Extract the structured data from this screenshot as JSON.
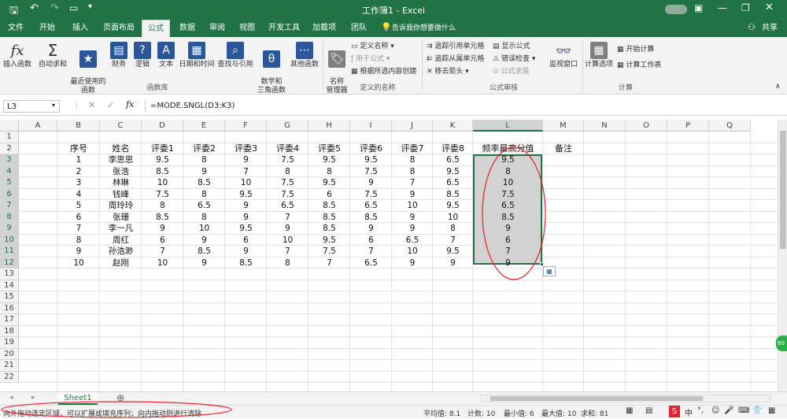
{
  "window": {
    "title": "工作簿1 - Excel"
  },
  "tabs": [
    "文件",
    "开始",
    "插入",
    "页面布局",
    "公式",
    "数据",
    "审阅",
    "视图",
    "开发工具",
    "加载项",
    "团队"
  ],
  "active_tab": "公式",
  "tell_me": "告诉我你想要做什么",
  "share": "共享",
  "ribbon": {
    "function_library": {
      "insert_function": "插入函数",
      "autosum": "自动求和",
      "recent": "最近使用的\n函数",
      "financial": "财务",
      "logical": "逻辑",
      "text": "文本",
      "datetime": "日期和时间",
      "lookup": "查找与引用",
      "math": "数学和\n三角函数",
      "more": "其他函数",
      "group": "函数库"
    },
    "defined_names": {
      "name_manager": "名称\n管理器",
      "define_name": "定义名称",
      "use_in_formula": "用于公式",
      "create_from_selection": "根据所选内容创建",
      "group": "定义的名称"
    },
    "formula_auditing": {
      "trace_precedents": "追踪引用单元格",
      "trace_dependents": "追踪从属单元格",
      "remove_arrows": "移去箭头",
      "show_formulas": "显示公式",
      "error_checking": "错误检查",
      "evaluate_formula": "公式求值",
      "watch_window": "监视窗口",
      "group": "公式审核"
    },
    "calculation": {
      "options": "计算选项",
      "calc_now": "开始计算",
      "calc_sheet": "计算工作表",
      "group": "计算"
    }
  },
  "formula_bar": {
    "name_box": "L3",
    "fx": "fx",
    "formula": "=MODE.SNGL(D3:K3)"
  },
  "columns": [
    "A",
    "B",
    "C",
    "D",
    "E",
    "F",
    "G",
    "H",
    "I",
    "J",
    "K",
    "L",
    "M",
    "N",
    "O",
    "P",
    "Q"
  ],
  "rows": [
    "1",
    "2",
    "3",
    "4",
    "5",
    "6",
    "7",
    "8",
    "9",
    "10",
    "11",
    "12",
    "13",
    "14",
    "15",
    "16",
    "17",
    "18",
    "19",
    "20",
    "21",
    "22"
  ],
  "headers": [
    "序号",
    "姓名",
    "评委1",
    "评委2",
    "评委3",
    "评委4",
    "评委5",
    "评委6",
    "评委7",
    "评委8",
    "频率最高分值",
    "备注"
  ],
  "data_rows": [
    [
      "1",
      "李思思",
      "9.5",
      "8",
      "9",
      "7.5",
      "9.5",
      "9.5",
      "8",
      "6.5",
      "9.5"
    ],
    [
      "2",
      "张浩",
      "8.5",
      "9",
      "7",
      "8",
      "8",
      "7.5",
      "8",
      "9.5",
      "8"
    ],
    [
      "3",
      "林琳",
      "10",
      "8.5",
      "10",
      "7.5",
      "9.5",
      "9",
      "7",
      "6.5",
      "10"
    ],
    [
      "4",
      "钱峰",
      "7.5",
      "8",
      "9.5",
      "7.5",
      "6",
      "7.5",
      "9",
      "8.5",
      "7.5"
    ],
    [
      "5",
      "周玲玲",
      "8",
      "6.5",
      "9",
      "6.5",
      "8.5",
      "6.5",
      "10",
      "9.5",
      "6.5"
    ],
    [
      "6",
      "张珊",
      "8.5",
      "8",
      "9",
      "7",
      "8.5",
      "8.5",
      "9",
      "10",
      "8.5"
    ],
    [
      "7",
      "李一凡",
      "9",
      "10",
      "9.5",
      "9",
      "8.5",
      "9",
      "9",
      "8",
      "9"
    ],
    [
      "8",
      "周红",
      "6",
      "9",
      "6",
      "10",
      "9.5",
      "6",
      "6.5",
      "7",
      "6"
    ],
    [
      "9",
      "孙浩渺",
      "7",
      "8.5",
      "9",
      "7",
      "7.5",
      "7",
      "10",
      "9.5",
      "7"
    ],
    [
      "10",
      "赵刚",
      "10",
      "9",
      "8.5",
      "8",
      "7",
      "6.5",
      "9",
      "9",
      "9"
    ]
  ],
  "sheet_tab": "Sheet1",
  "status": {
    "hint": "向外拖动选定区域，可以扩展或填充序列；向内拖动则进行清除",
    "average": "平均值: 8.1",
    "count": "计数: 10",
    "min": "最小值: 6",
    "max": "最大值: 10",
    "sum": "求和: 81"
  },
  "colors": {
    "brand": "#217346",
    "selection": "#d2d2d2",
    "annotation": "#e8212a"
  }
}
